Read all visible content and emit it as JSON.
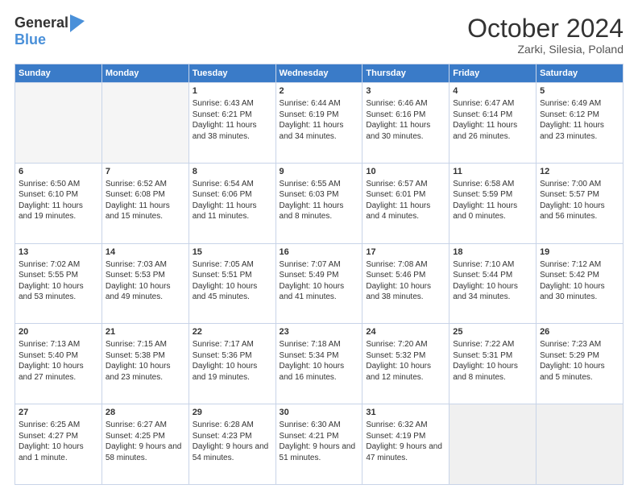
{
  "header": {
    "logo_line1": "General",
    "logo_line2": "Blue",
    "month_title": "October 2024",
    "location": "Zarki, Silesia, Poland"
  },
  "days_of_week": [
    "Sunday",
    "Monday",
    "Tuesday",
    "Wednesday",
    "Thursday",
    "Friday",
    "Saturday"
  ],
  "weeks": [
    [
      {
        "day": "",
        "info": ""
      },
      {
        "day": "",
        "info": ""
      },
      {
        "day": "1",
        "info": "Sunrise: 6:43 AM\nSunset: 6:21 PM\nDaylight: 11 hours and 38 minutes."
      },
      {
        "day": "2",
        "info": "Sunrise: 6:44 AM\nSunset: 6:19 PM\nDaylight: 11 hours and 34 minutes."
      },
      {
        "day": "3",
        "info": "Sunrise: 6:46 AM\nSunset: 6:16 PM\nDaylight: 11 hours and 30 minutes."
      },
      {
        "day": "4",
        "info": "Sunrise: 6:47 AM\nSunset: 6:14 PM\nDaylight: 11 hours and 26 minutes."
      },
      {
        "day": "5",
        "info": "Sunrise: 6:49 AM\nSunset: 6:12 PM\nDaylight: 11 hours and 23 minutes."
      }
    ],
    [
      {
        "day": "6",
        "info": "Sunrise: 6:50 AM\nSunset: 6:10 PM\nDaylight: 11 hours and 19 minutes."
      },
      {
        "day": "7",
        "info": "Sunrise: 6:52 AM\nSunset: 6:08 PM\nDaylight: 11 hours and 15 minutes."
      },
      {
        "day": "8",
        "info": "Sunrise: 6:54 AM\nSunset: 6:06 PM\nDaylight: 11 hours and 11 minutes."
      },
      {
        "day": "9",
        "info": "Sunrise: 6:55 AM\nSunset: 6:03 PM\nDaylight: 11 hours and 8 minutes."
      },
      {
        "day": "10",
        "info": "Sunrise: 6:57 AM\nSunset: 6:01 PM\nDaylight: 11 hours and 4 minutes."
      },
      {
        "day": "11",
        "info": "Sunrise: 6:58 AM\nSunset: 5:59 PM\nDaylight: 11 hours and 0 minutes."
      },
      {
        "day": "12",
        "info": "Sunrise: 7:00 AM\nSunset: 5:57 PM\nDaylight: 10 hours and 56 minutes."
      }
    ],
    [
      {
        "day": "13",
        "info": "Sunrise: 7:02 AM\nSunset: 5:55 PM\nDaylight: 10 hours and 53 minutes."
      },
      {
        "day": "14",
        "info": "Sunrise: 7:03 AM\nSunset: 5:53 PM\nDaylight: 10 hours and 49 minutes."
      },
      {
        "day": "15",
        "info": "Sunrise: 7:05 AM\nSunset: 5:51 PM\nDaylight: 10 hours and 45 minutes."
      },
      {
        "day": "16",
        "info": "Sunrise: 7:07 AM\nSunset: 5:49 PM\nDaylight: 10 hours and 41 minutes."
      },
      {
        "day": "17",
        "info": "Sunrise: 7:08 AM\nSunset: 5:46 PM\nDaylight: 10 hours and 38 minutes."
      },
      {
        "day": "18",
        "info": "Sunrise: 7:10 AM\nSunset: 5:44 PM\nDaylight: 10 hours and 34 minutes."
      },
      {
        "day": "19",
        "info": "Sunrise: 7:12 AM\nSunset: 5:42 PM\nDaylight: 10 hours and 30 minutes."
      }
    ],
    [
      {
        "day": "20",
        "info": "Sunrise: 7:13 AM\nSunset: 5:40 PM\nDaylight: 10 hours and 27 minutes."
      },
      {
        "day": "21",
        "info": "Sunrise: 7:15 AM\nSunset: 5:38 PM\nDaylight: 10 hours and 23 minutes."
      },
      {
        "day": "22",
        "info": "Sunrise: 7:17 AM\nSunset: 5:36 PM\nDaylight: 10 hours and 19 minutes."
      },
      {
        "day": "23",
        "info": "Sunrise: 7:18 AM\nSunset: 5:34 PM\nDaylight: 10 hours and 16 minutes."
      },
      {
        "day": "24",
        "info": "Sunrise: 7:20 AM\nSunset: 5:32 PM\nDaylight: 10 hours and 12 minutes."
      },
      {
        "day": "25",
        "info": "Sunrise: 7:22 AM\nSunset: 5:31 PM\nDaylight: 10 hours and 8 minutes."
      },
      {
        "day": "26",
        "info": "Sunrise: 7:23 AM\nSunset: 5:29 PM\nDaylight: 10 hours and 5 minutes."
      }
    ],
    [
      {
        "day": "27",
        "info": "Sunrise: 6:25 AM\nSunset: 4:27 PM\nDaylight: 10 hours and 1 minute."
      },
      {
        "day": "28",
        "info": "Sunrise: 6:27 AM\nSunset: 4:25 PM\nDaylight: 9 hours and 58 minutes."
      },
      {
        "day": "29",
        "info": "Sunrise: 6:28 AM\nSunset: 4:23 PM\nDaylight: 9 hours and 54 minutes."
      },
      {
        "day": "30",
        "info": "Sunrise: 6:30 AM\nSunset: 4:21 PM\nDaylight: 9 hours and 51 minutes."
      },
      {
        "day": "31",
        "info": "Sunrise: 6:32 AM\nSunset: 4:19 PM\nDaylight: 9 hours and 47 minutes."
      },
      {
        "day": "",
        "info": ""
      },
      {
        "day": "",
        "info": ""
      }
    ]
  ]
}
